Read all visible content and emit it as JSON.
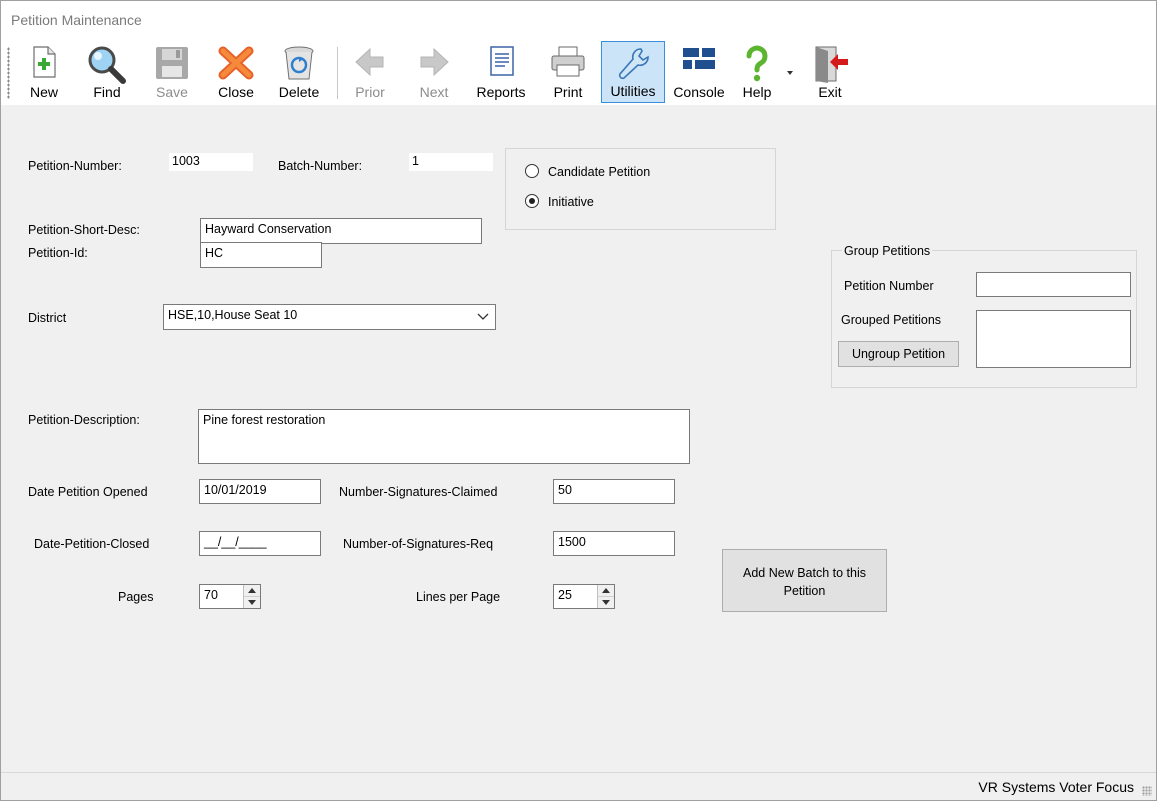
{
  "window": {
    "title": "Petition Maintenance"
  },
  "toolbar": {
    "new": "New",
    "find": "Find",
    "save": "Save",
    "close": "Close",
    "delete": "Delete",
    "prior": "Prior",
    "next": "Next",
    "reports": "Reports",
    "print": "Print",
    "utilities": "Utilities",
    "console": "Console",
    "help": "Help",
    "exit": "Exit"
  },
  "form": {
    "petition_number_label": "Petition-Number:",
    "petition_number_value": "1003",
    "batch_number_label": "Batch-Number:",
    "batch_number_value": "1",
    "type_options": {
      "candidate": "Candidate Petition",
      "initiative": "Initiative",
      "selected": "Initiative"
    },
    "short_desc_label": "Petition-Short-Desc:",
    "short_desc_value": "Hayward Conservation",
    "petition_id_label": "Petition-Id:",
    "petition_id_value": "HC",
    "district_label": "District",
    "district_value": "HSE,10,House Seat 10",
    "description_label": "Petition-Description:",
    "description_value": "Pine forest restoration",
    "date_opened_label": "Date Petition Opened",
    "date_opened_value": "10/01/2019",
    "sigs_claimed_label": "Number-Signatures-Claimed",
    "sigs_claimed_value": "50",
    "date_closed_label": "Date-Petition-Closed",
    "date_closed_value": "__/__/____",
    "sigs_req_label": "Number-of-Signatures-Req",
    "sigs_req_value": "1500",
    "pages_label": "Pages",
    "pages_value": "70",
    "lines_label": "Lines per Page",
    "lines_value": "25",
    "add_batch_button": "Add New Batch to this Petition"
  },
  "group": {
    "title": "Group Petitions",
    "petition_number_label": "Petition Number",
    "petition_number_value": "",
    "grouped_label": "Grouped Petitions",
    "ungroup_button": "Ungroup Petition"
  },
  "status": {
    "text": "VR Systems Voter Focus"
  },
  "icons": {
    "new": "new-document-icon",
    "find": "magnifier-icon",
    "save": "floppy-disk-icon",
    "close": "red-x-icon",
    "delete": "recycle-bin-icon",
    "prior": "left-arrow-icon",
    "next": "right-arrow-icon",
    "reports": "report-document-icon",
    "print": "printer-icon",
    "utilities": "wrench-icon",
    "console": "console-tiles-icon",
    "help": "question-mark-icon",
    "exit": "exit-door-icon"
  }
}
